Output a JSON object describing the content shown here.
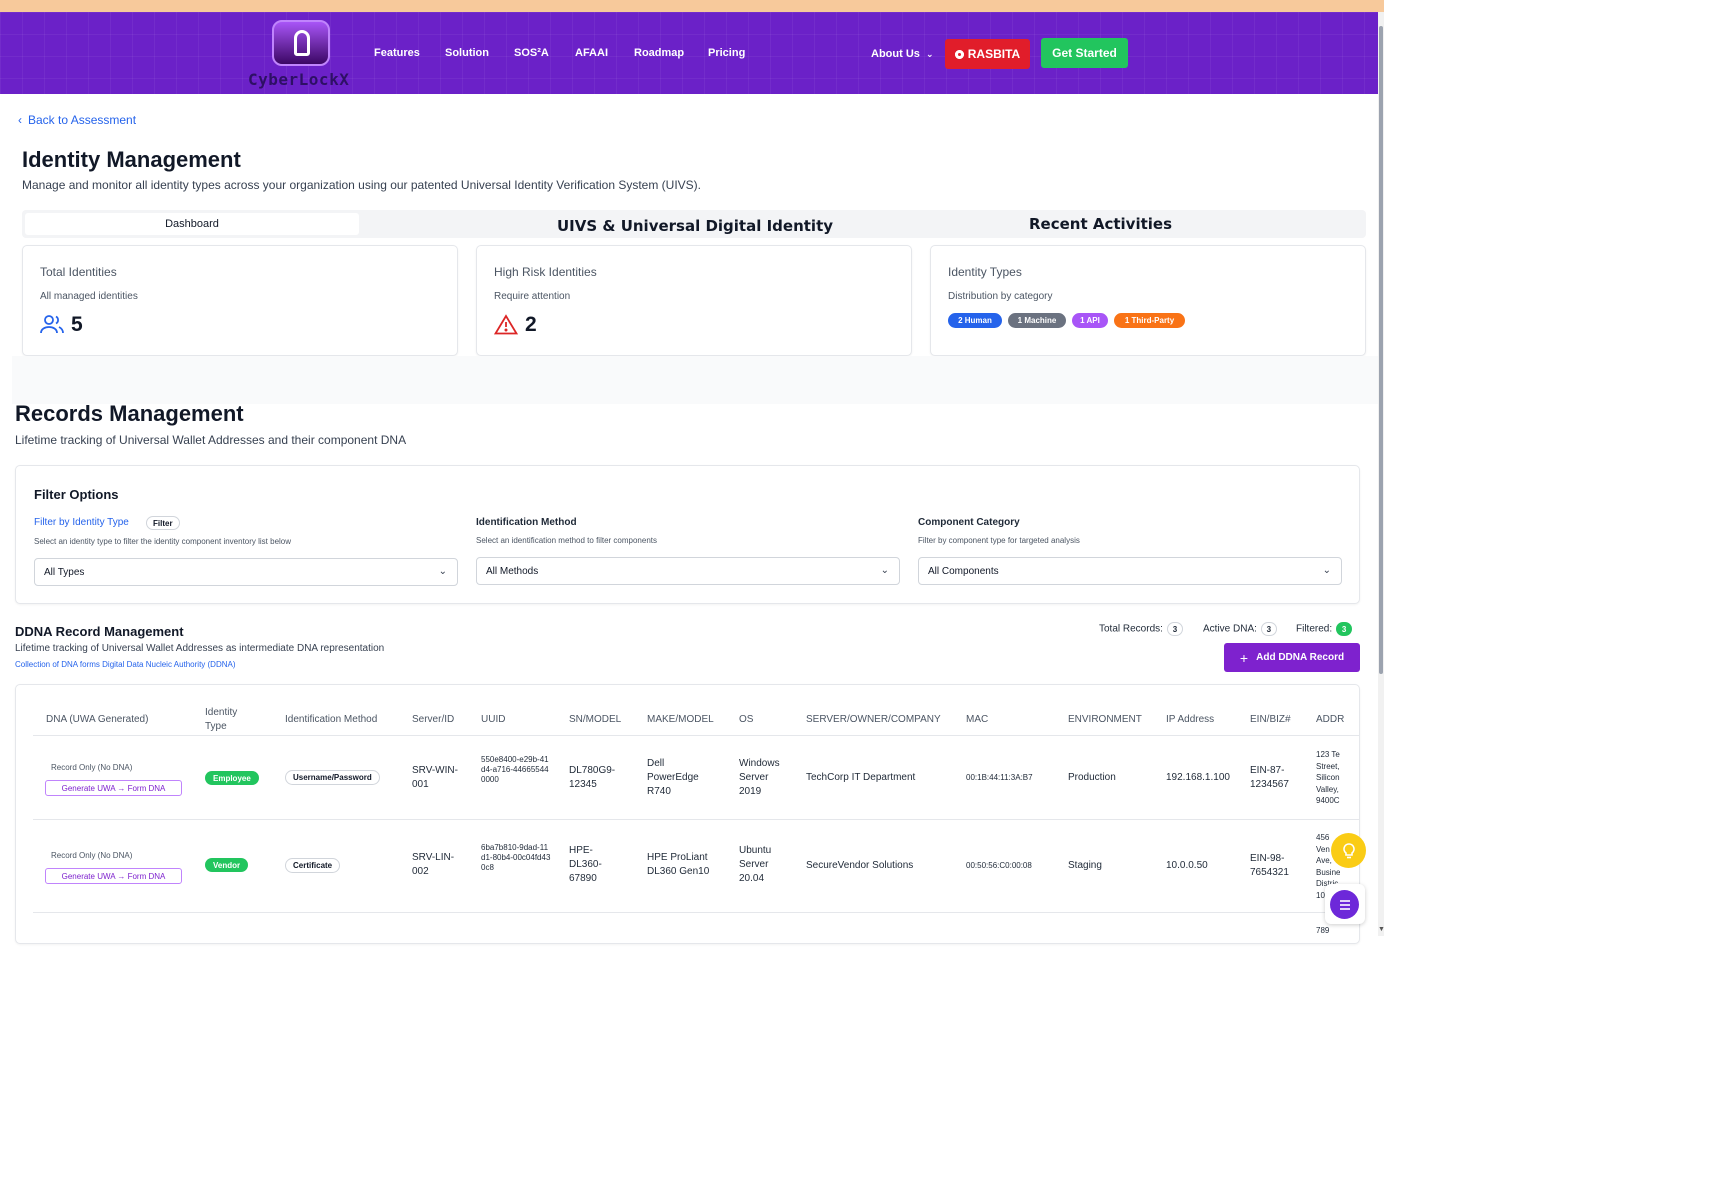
{
  "nav": {
    "logo_text": "CyberLockX",
    "links": [
      "Features",
      "Solution",
      "SOS²A",
      "AFAAI",
      "Roadmap",
      "Pricing"
    ],
    "about": "About Us",
    "rasbita": "RASBITA",
    "get_started": "Get Started"
  },
  "back_link": "Back to Assessment",
  "page": {
    "title": "Identity Management",
    "subtitle": "Manage and monitor all identity types across your organization using our patented Universal Identity Verification System (UIVS)."
  },
  "tabs": [
    "Dashboard",
    "UIVS & Universal Digital Identity",
    "Recent Activities"
  ],
  "stats": {
    "total": {
      "title": "Total Identities",
      "desc": "All managed identities",
      "value": "5"
    },
    "high_risk": {
      "title": "High Risk Identities",
      "desc": "Require attention",
      "value": "2"
    },
    "types": {
      "title": "Identity Types",
      "desc": "Distribution by category",
      "pills": [
        "2 Human",
        "1 Machine",
        "1 API",
        "1 Third-Party"
      ]
    }
  },
  "colors": {
    "nav_bg": "#6b21c8",
    "human": "#2563eb",
    "machine": "#6b7280",
    "api": "#a855f7",
    "third_party": "#f97316",
    "accent": "#7e22ce"
  },
  "records": {
    "title": "Records Management",
    "subtitle": "Lifetime tracking of Universal Wallet Addresses and their component DNA"
  },
  "filters": {
    "title": "Filter Options",
    "identity": {
      "label": "Filter by Identity Type",
      "badge": "Filter",
      "help": "Select an identity type to filter the identity component inventory list below",
      "value": "All Types"
    },
    "method": {
      "label": "Identification Method",
      "help": "Select an identification method to filter components",
      "value": "All Methods"
    },
    "component": {
      "label": "Component Category",
      "help": "Filter by component type for targeted analysis",
      "value": "All Components"
    }
  },
  "ddna": {
    "title": "DDNA Record Management",
    "subtitle": "Lifetime tracking of Universal Wallet Addresses as intermediate DNA representation",
    "link": "Collection of DNA forms Digital Data Nucleic Authority (DDNA)",
    "total_label": "Total Records:",
    "total": "3",
    "active_label": "Active DNA:",
    "active": "3",
    "filtered_label": "Filtered:",
    "filtered": "3",
    "add_button": "Add DDNA Record"
  },
  "table": {
    "headers": [
      "DNA (UWA Generated)",
      "Identity Type",
      "Identification Method",
      "Server/ID",
      "UUID",
      "SN/MODEL",
      "MAKE/MODEL",
      "OS",
      "SERVER/OWNER/COMPANY",
      "MAC",
      "ENVIRONMENT",
      "IP Address",
      "EIN/BIZ#",
      "ADDR"
    ],
    "rows": [
      {
        "status": "Record Only (No DNA)",
        "action": "Generate UWA → Form DNA",
        "type": "Employee",
        "method": "Username/Password",
        "server": "SRV-WIN-001",
        "uuid": "550e8400-e29b-41d4-a716-446655440000",
        "sn": "DL780G9-12345",
        "make": "Dell PowerEdge R740",
        "os": "Windows Server 2019",
        "owner": "TechCorp IT Department",
        "mac": "00:1B:44:11:3A:B7",
        "env": "Production",
        "ip": "192.168.1.100",
        "ein": "EIN-87-1234567",
        "addr": "123 Te Street, Silicon Valley, 9400C"
      },
      {
        "status": "Record Only (No DNA)",
        "action": "Generate UWA → Form DNA",
        "type": "Vendor",
        "method": "Certificate",
        "server": "SRV-LIN-002",
        "uuid": "6ba7b810-9dad-11d1-80b4-00c04fd430c8",
        "sn": "HPE-DL360-67890",
        "make": "HPE ProLiant DL360 Gen10",
        "os": "Ubuntu Server 20.04",
        "owner": "SecureVendor Solutions",
        "mac": "00:50:56:C0:00:08",
        "env": "Staging",
        "ip": "10.0.0.50",
        "ein": "EIN-98-7654321",
        "addr": "456 Ven Ave, Busine Distric 10"
      }
    ],
    "next_row_addr": "789"
  }
}
